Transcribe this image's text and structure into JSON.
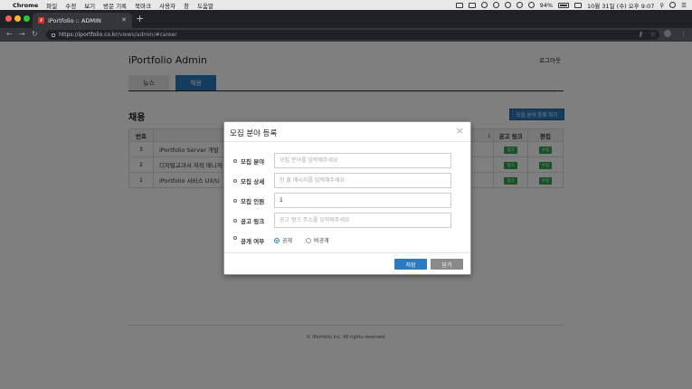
{
  "menubar": {
    "app": "Chrome",
    "items": [
      "파일",
      "수정",
      "보기",
      "방문 기록",
      "북마크",
      "사용자",
      "창",
      "도움말"
    ],
    "battery": "94%",
    "datetime": "10월 31일 (수) 오후 9:07"
  },
  "browser": {
    "tab_title": "iPortfolio :: ADMIN",
    "favicon_text": "iP",
    "url_host": "https://iportfolio.co.kr",
    "url_path": "/views/admin/#career"
  },
  "page": {
    "brand": "iPortfolio Admin",
    "logout": "로그아웃",
    "tabs": [
      {
        "label": "뉴스",
        "active": false
      },
      {
        "label": "채용",
        "active": true
      }
    ],
    "section_title": "채용",
    "add_button": "모집 분야 등록 하기",
    "table": {
      "headers": [
        "번호",
        "",
        "",
        "공고 링크",
        "편집"
      ],
      "header_fragment": ":",
      "rows": [
        {
          "num": "3",
          "title": "iPortfolio Server 개발",
          "link": "링크",
          "edit": "수정"
        },
        {
          "num": "2",
          "title": "디지털교과서 저작 매니저",
          "link": "링크",
          "edit": "수정"
        },
        {
          "num": "1",
          "title": "iPortfolio 서비스 UX/U",
          "link": "링크",
          "edit": "수정"
        }
      ]
    },
    "footer": "© iPortfolio Inc. All rights reserved."
  },
  "modal": {
    "title": "모집 분야 등록",
    "fields": [
      {
        "label": "모집 분야",
        "value": "",
        "placeholder": "모집 분야를 입력해주세요"
      },
      {
        "label": "모집 상세",
        "value": "",
        "placeholder": "한 줄 메시지를 입력해주세요"
      },
      {
        "label": "모집 인원",
        "value": "1",
        "placeholder": ""
      },
      {
        "label": "공고 링크",
        "value": "",
        "placeholder": "공고 링크 주소를 입력해주세요"
      }
    ],
    "visibility": {
      "label": "공개 여부",
      "options": [
        "공개",
        "비공개"
      ],
      "selected": "공개"
    },
    "save": "저장",
    "close": "닫기"
  },
  "colors": {
    "primary": "#2a7bbf",
    "success": "#2ea44f",
    "close_button": "#8a8a8a"
  }
}
